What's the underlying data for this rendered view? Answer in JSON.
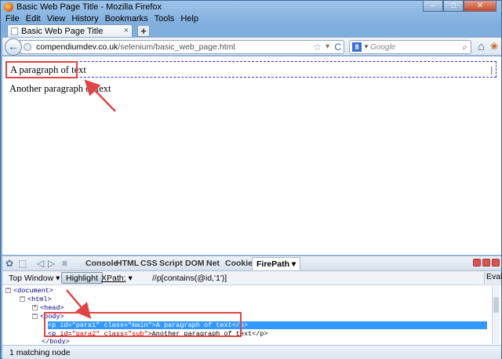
{
  "window": {
    "title": "Basic Web Page Title - Mozilla Firefox",
    "minimize": "–",
    "maximize": "□",
    "close": "✕"
  },
  "menu": [
    "File",
    "Edit",
    "View",
    "History",
    "Bookmarks",
    "Tools",
    "Help"
  ],
  "tab": {
    "title": "Basic Web Page Title",
    "close": "×",
    "new_tab": "+"
  },
  "nav": {
    "back": "←",
    "url_domain": "compendiumdev.co.uk",
    "url_path": "/selenium/basic_web_page.html",
    "star": "☆",
    "reload": "C",
    "search_engine": "8",
    "search_placeholder": "Google",
    "search_icon": "⌕",
    "home": "⌂",
    "firebug": "❀"
  },
  "page": {
    "para1": "A paragraph of text",
    "para2": "Another paragraph of text"
  },
  "firebug": {
    "panel_tabs": [
      "Console",
      "HTML",
      "CSS",
      "Script",
      "DOM",
      "Net",
      "Cookies"
    ],
    "active_tab": "FirePath ▾",
    "top_window": "Top Window ▾",
    "highlight": "Highlight",
    "xpath_label": "XPath:",
    "xpath_value": "//p[contains(@id,'1')]",
    "eval": "Eval",
    "status": "1 matching node"
  },
  "dom": {
    "document": "<document>",
    "html": "<html>",
    "head": "<head>",
    "body": "<body>",
    "p1_open": "<p ",
    "p1_attr1": "id=",
    "p1_val1": "\"para1\"",
    "p1_attr2": " class=",
    "p1_val2": "\"main\"",
    "p1_text": ">A paragraph of text</p>",
    "p2_open": "<p ",
    "p2_attr1": "id=",
    "p2_val1": "\"para2\"",
    "p2_attr2": " class=",
    "p2_val2": "\"sub\"",
    "p2_text": ">Another paragraph of text</p>",
    "body_close": "</body>"
  },
  "colors": {
    "annotation_red": "#e04444",
    "selection_blue": "#3399ff",
    "highlight_dash": "#3333cc"
  }
}
